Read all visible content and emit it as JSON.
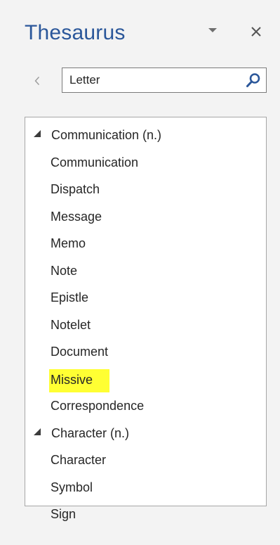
{
  "pane": {
    "title": "Thesaurus"
  },
  "search": {
    "value": "Letter",
    "placeholder": ""
  },
  "icons": {
    "dropdown": "chevron-down-icon",
    "close": "close-icon",
    "back": "chevron-left-icon",
    "search": "search-icon",
    "expanded": "triangle-expanded-icon"
  },
  "colors": {
    "title": "#2b579a",
    "search_icon": "#2b579a",
    "highlight": "#ffff33"
  },
  "results": [
    {
      "type": "heading",
      "label": "Communication (n.)",
      "expanded": true
    },
    {
      "type": "word",
      "label": "Communication"
    },
    {
      "type": "word",
      "label": "Dispatch"
    },
    {
      "type": "word",
      "label": "Message"
    },
    {
      "type": "word",
      "label": "Memo"
    },
    {
      "type": "word",
      "label": "Note"
    },
    {
      "type": "word",
      "label": "Epistle"
    },
    {
      "type": "word",
      "label": "Notelet"
    },
    {
      "type": "word",
      "label": "Document"
    },
    {
      "type": "word",
      "label": "Missive",
      "highlighted": true
    },
    {
      "type": "word",
      "label": "Correspondence"
    },
    {
      "type": "heading",
      "label": "Character (n.)",
      "expanded": true
    },
    {
      "type": "word",
      "label": "Character"
    },
    {
      "type": "word",
      "label": "Symbol"
    },
    {
      "type": "word",
      "label": "Sign"
    }
  ]
}
